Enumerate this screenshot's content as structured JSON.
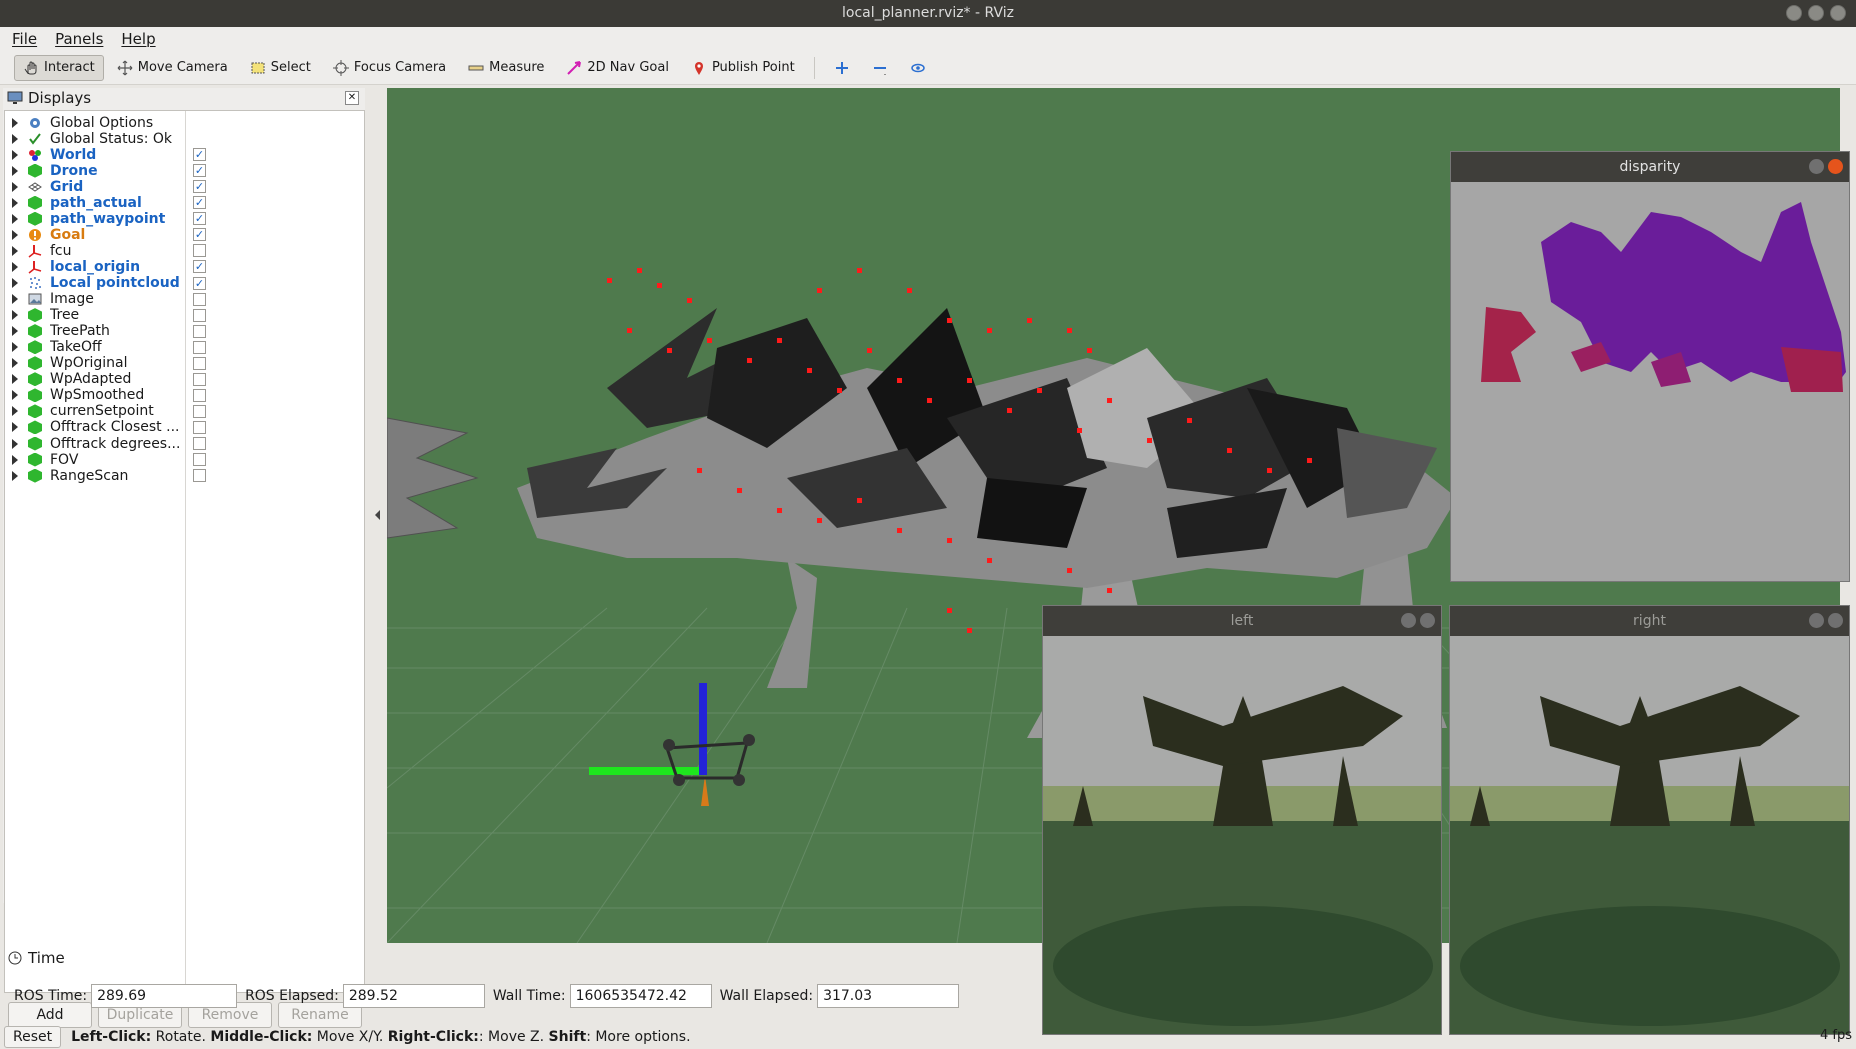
{
  "window": {
    "title": "local_planner.rviz* - RViz"
  },
  "menu": [
    "File",
    "Panels",
    "Help"
  ],
  "toolbar": {
    "interact": "Interact",
    "move_camera": "Move Camera",
    "select": "Select",
    "focus_camera": "Focus Camera",
    "measure": "Measure",
    "nav_goal": "2D Nav Goal",
    "publish_point": "Publish Point"
  },
  "displays": {
    "title": "Displays",
    "items": [
      {
        "label": "Global Options",
        "style": "plain",
        "icon": "gear-icon",
        "checked": null
      },
      {
        "label": "Global Status: Ok",
        "style": "plain",
        "icon": "checkmark-icon",
        "checked": null
      },
      {
        "label": "World",
        "style": "blue",
        "icon": "world-icon",
        "checked": true
      },
      {
        "label": "Drone",
        "style": "blue",
        "icon": "cube-icon",
        "checked": true
      },
      {
        "label": "Grid",
        "style": "blue",
        "icon": "grid-icon",
        "checked": true
      },
      {
        "label": "path_actual",
        "style": "blue",
        "icon": "cube-icon",
        "checked": true
      },
      {
        "label": "path_waypoint",
        "style": "blue",
        "icon": "cube-icon",
        "checked": true
      },
      {
        "label": "Goal",
        "style": "orange",
        "icon": "warning-icon",
        "checked": true
      },
      {
        "label": "fcu",
        "style": "plain",
        "icon": "axes-icon",
        "checked": false
      },
      {
        "label": "local_origin",
        "style": "blue",
        "icon": "axes-icon",
        "checked": true
      },
      {
        "label": "Local pointcloud",
        "style": "blue",
        "icon": "pointcloud-icon",
        "checked": true
      },
      {
        "label": "Image",
        "style": "plain",
        "icon": "image-icon",
        "checked": false
      },
      {
        "label": "Tree",
        "style": "plain",
        "icon": "cube-icon",
        "checked": false
      },
      {
        "label": "TreePath",
        "style": "plain",
        "icon": "cube-icon",
        "checked": false
      },
      {
        "label": "TakeOff",
        "style": "plain",
        "icon": "cube-icon",
        "checked": false
      },
      {
        "label": "WpOriginal",
        "style": "plain",
        "icon": "cube-icon",
        "checked": false
      },
      {
        "label": "WpAdapted",
        "style": "plain",
        "icon": "cube-icon",
        "checked": false
      },
      {
        "label": "WpSmoothed",
        "style": "plain",
        "icon": "cube-icon",
        "checked": false
      },
      {
        "label": "currenSetpoint",
        "style": "plain",
        "icon": "cube-icon",
        "checked": false
      },
      {
        "label": "Offtrack Closest ...",
        "style": "plain",
        "icon": "cube-icon",
        "checked": false
      },
      {
        "label": "Offtrack degrees...",
        "style": "plain",
        "icon": "cube-icon",
        "checked": false
      },
      {
        "label": "FOV",
        "style": "plain",
        "icon": "cube-icon",
        "checked": false
      },
      {
        "label": "RangeScan",
        "style": "plain",
        "icon": "cube-icon",
        "checked": false
      }
    ],
    "buttons": {
      "add": "Add",
      "duplicate": "Duplicate",
      "remove": "Remove",
      "rename": "Rename"
    }
  },
  "image_windows": {
    "disparity": "disparity",
    "left": "left",
    "right": "right"
  },
  "time_panel": {
    "title": "Time",
    "ros_time_label": "ROS Time:",
    "ros_time": "289.69",
    "ros_elapsed_label": "ROS Elapsed:",
    "ros_elapsed": "289.52",
    "wall_time_label": "Wall Time:",
    "wall_time": "1606535472.42",
    "wall_elapsed_label": "Wall Elapsed:",
    "wall_elapsed": "317.03"
  },
  "status": {
    "reset": "Reset",
    "hint_b1": "Left-Click:",
    "hint_t1": " Rotate. ",
    "hint_b2": "Middle-Click:",
    "hint_t2": " Move X/Y. ",
    "hint_b3": "Right-Click:",
    "hint_t3": ": Move Z. ",
    "hint_b4": "Shift",
    "hint_t4": ": More options.",
    "fps": "4 fps"
  },
  "colors": {
    "viewport_bg": "#4f7a4d",
    "blue_label": "#1a63c2",
    "orange_label": "#d87b10"
  }
}
